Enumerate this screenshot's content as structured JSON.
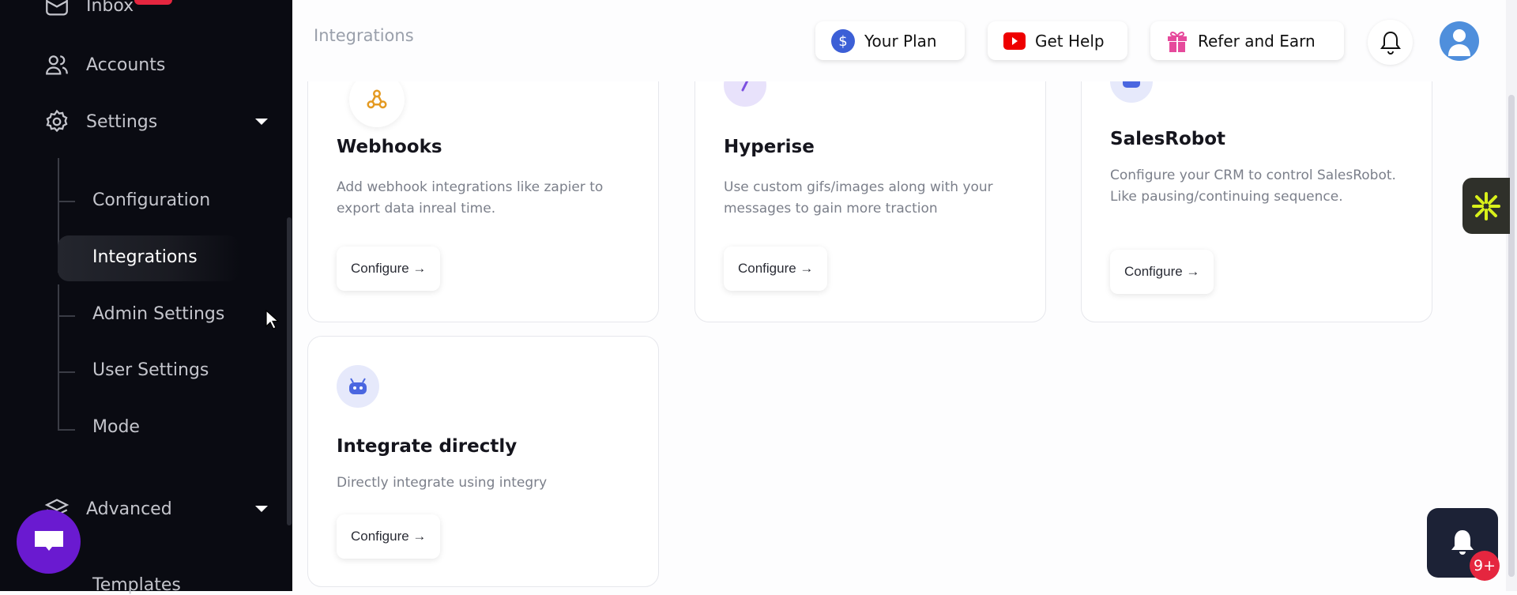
{
  "sidebar": {
    "items": [
      {
        "label": "Inbox",
        "icon": "inbox-icon"
      },
      {
        "label": "Accounts",
        "icon": "users-icon"
      },
      {
        "label": "Settings",
        "icon": "gear-icon"
      },
      {
        "label": "Advanced",
        "icon": "layers-icon"
      }
    ],
    "settings_sub": [
      "Configuration",
      "Integrations",
      "Admin Settings",
      "User Settings",
      "Mode"
    ],
    "advanced_sub": [
      "Templates"
    ]
  },
  "header": {
    "title": "Integrations",
    "your_plan": "Your Plan",
    "get_help": "Get Help",
    "refer": "Refer and Earn"
  },
  "cards": [
    {
      "title": "Webhooks",
      "desc": "Add webhook integrations like zapier to export data inreal time.",
      "button": "Configure →"
    },
    {
      "title": "Hyperise",
      "desc": "Use custom gifs/images along with your messages to gain more traction",
      "button": "Configure →"
    },
    {
      "title": "SalesRobot",
      "desc": "Configure your CRM to control SalesRobot. Like pausing/continuing sequence.",
      "button": "Configure →"
    },
    {
      "title": "Integrate directly",
      "desc": "Directly integrate using integry",
      "button": "Configure →"
    }
  ],
  "notifications": {
    "count": "9+"
  },
  "colors": {
    "sidebar_bg": "#0a0b12",
    "chat": "#6a1ad0",
    "badge": "#e5263f",
    "accent": "#4f8fdc"
  }
}
